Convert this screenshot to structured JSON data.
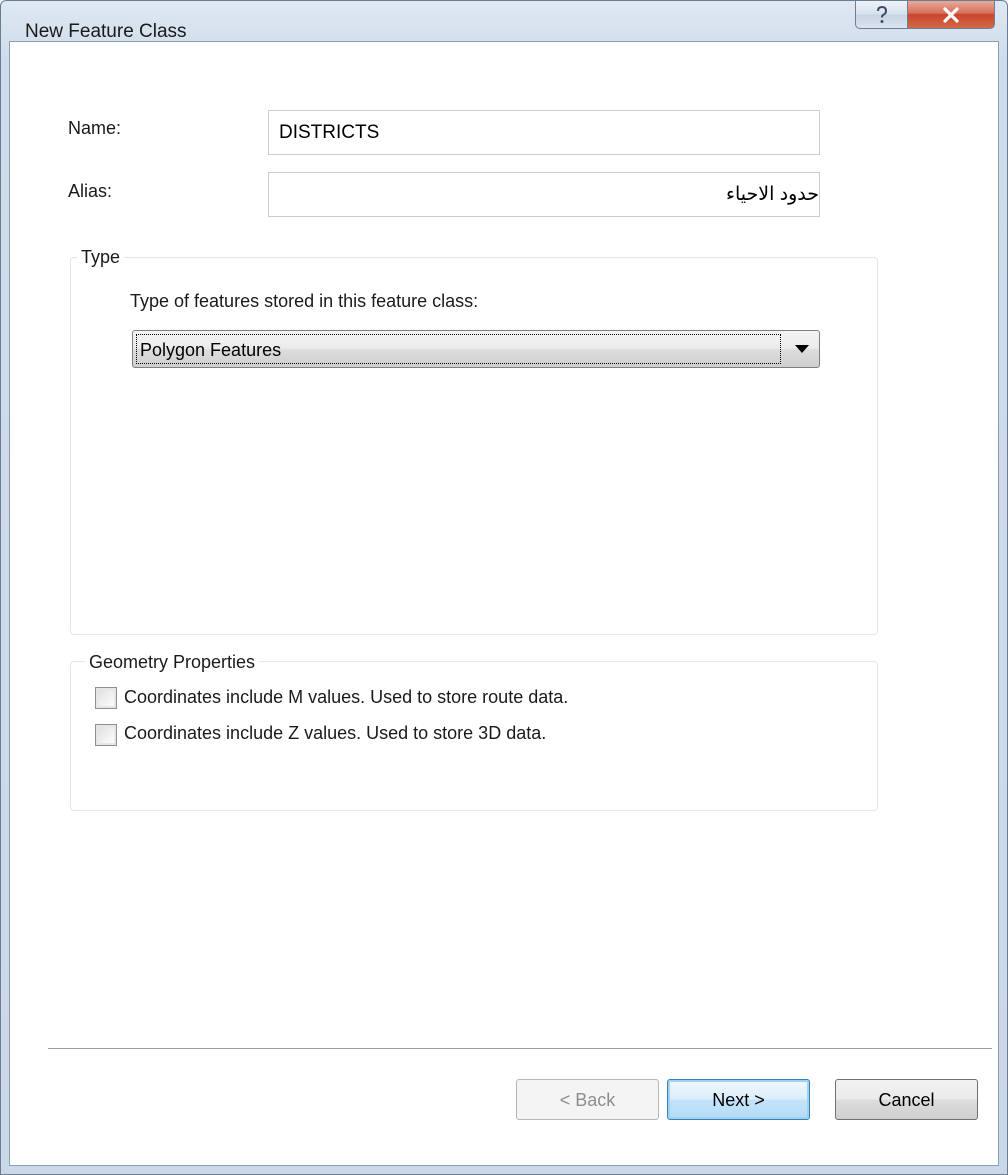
{
  "window": {
    "title": "New Feature Class",
    "help_icon": "?",
    "close_icon": "X"
  },
  "form": {
    "name_label": "Name:",
    "name_value": "DISTRICTS",
    "alias_label": "Alias:",
    "alias_value": "حدود الاحياء"
  },
  "type_group": {
    "legend": "Type",
    "prompt": "Type of features stored in this feature class:",
    "selected": "Polygon Features"
  },
  "geometry_group": {
    "legend": "Geometry Properties",
    "options": [
      {
        "label": "Coordinates include M values. Used to store route data.",
        "checked": false
      },
      {
        "label": "Coordinates include Z values. Used to store 3D data.",
        "checked": false
      }
    ]
  },
  "buttons": {
    "back": "< Back",
    "next": "Next >",
    "cancel": "Cancel"
  }
}
